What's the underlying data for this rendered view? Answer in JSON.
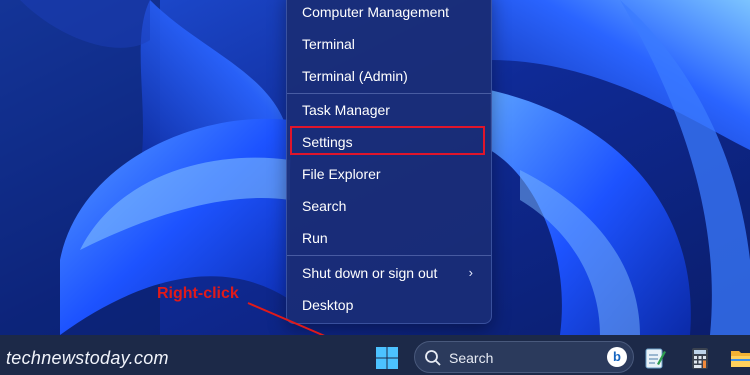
{
  "watermark": "technewstoday.com",
  "annotation": "Right-click",
  "menu": {
    "items": [
      {
        "label": "Computer Management"
      },
      {
        "label": "Terminal"
      },
      {
        "label": "Terminal (Admin)"
      },
      {
        "label": "Task Manager"
      },
      {
        "label": "Settings",
        "highlighted": true
      },
      {
        "label": "File Explorer"
      },
      {
        "label": "Search"
      },
      {
        "label": "Run"
      },
      {
        "label": "Shut down or sign out",
        "submenu": true
      },
      {
        "label": "Desktop"
      }
    ],
    "submenu_glyph": "›"
  },
  "taskbar": {
    "search_placeholder": "Search",
    "bing_glyph": "b",
    "icons": [
      "windows-start-icon",
      "search-icon",
      "bing-icon",
      "notepad-icon",
      "calculator-icon",
      "file-explorer-icon"
    ]
  },
  "colors": {
    "highlight_box": "#e0152b",
    "annotation": "#e01a1a",
    "taskbar": "#1c2948",
    "menu_bg": "#1a2d76",
    "accent_blue": "#1b57ff"
  }
}
